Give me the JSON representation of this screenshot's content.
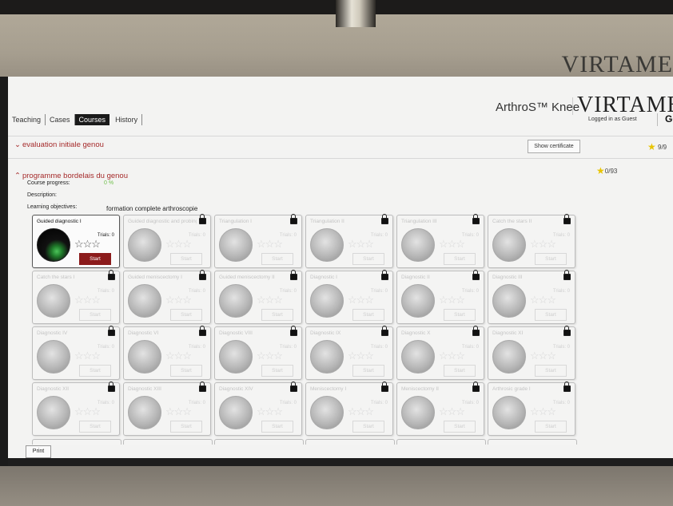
{
  "wall_brand": "VIRTAME",
  "header": {
    "app_title": "ArthroS™ Knee",
    "brand": "VIRTAMED",
    "logged_in": "Logged in as Guest",
    "logout_icon": "logout-icon"
  },
  "nav": {
    "tabs": [
      "Teaching",
      "Cases",
      "Courses",
      "History"
    ],
    "active": "Courses"
  },
  "section_evaluation": {
    "label": "evaluation initiale genou",
    "certificate_button": "Show certificate",
    "score": "9/9"
  },
  "section_programme": {
    "label": "programme bordelais du genou",
    "score": "0/93",
    "progress_label": "Course progress:",
    "progress_value": "0 %",
    "description_label": "Description:",
    "objectives_label": "Learning objectives:",
    "objectives_value": "formation complete arthroscopie"
  },
  "cards": [
    {
      "title": "Guided diagnostic I",
      "trials": "Trials: 0",
      "start": "Start",
      "locked": false
    },
    {
      "title": "Guided diagnostic and probing",
      "trials": "Trials: 0",
      "start": "Start",
      "locked": true
    },
    {
      "title": "Triangulation I",
      "trials": "Trials: 0",
      "start": "Start",
      "locked": true
    },
    {
      "title": "Triangulation II",
      "trials": "Trials: 0",
      "start": "Start",
      "locked": true
    },
    {
      "title": "Triangulation III",
      "trials": "Trials: 0",
      "start": "Start",
      "locked": true
    },
    {
      "title": "Catch the stars II",
      "trials": "Trials: 0",
      "start": "Start",
      "locked": true
    },
    {
      "title": "Catch the stars I",
      "trials": "Trials: 0",
      "start": "Start",
      "locked": true
    },
    {
      "title": "Guided meniscectomy I",
      "trials": "Trials: 0",
      "start": "Start",
      "locked": true
    },
    {
      "title": "Guided meniscectomy II",
      "trials": "Trials: 0",
      "start": "Start",
      "locked": true
    },
    {
      "title": "Diagnostic I",
      "trials": "Trials: 0",
      "start": "Start",
      "locked": true
    },
    {
      "title": "Diagnostic II",
      "trials": "Trials: 0",
      "start": "Start",
      "locked": true
    },
    {
      "title": "Diagnostic III",
      "trials": "Trials: 0",
      "start": "Start",
      "locked": true
    },
    {
      "title": "Diagnostic IV",
      "trials": "Trials: 0",
      "start": "Start",
      "locked": true
    },
    {
      "title": "Diagnostic VI",
      "trials": "Trials: 0",
      "start": "Start",
      "locked": true
    },
    {
      "title": "Diagnostic VIII",
      "trials": "Trials: 0",
      "start": "Start",
      "locked": true
    },
    {
      "title": "Diagnostic IX",
      "trials": "Trials: 0",
      "start": "Start",
      "locked": true
    },
    {
      "title": "Diagnostic X",
      "trials": "Trials: 0",
      "start": "Start",
      "locked": true
    },
    {
      "title": "Diagnostic XI",
      "trials": "Trials: 0",
      "start": "Start",
      "locked": true
    },
    {
      "title": "Diagnostic XII",
      "trials": "Trials: 0",
      "start": "Start",
      "locked": true
    },
    {
      "title": "Diagnostic XIII",
      "trials": "Trials: 0",
      "start": "Start",
      "locked": true
    },
    {
      "title": "Diagnostic XIV",
      "trials": "Trials: 0",
      "start": "Start",
      "locked": true
    },
    {
      "title": "Meniscectomy I",
      "trials": "Trials: 0",
      "start": "Start",
      "locked": true
    },
    {
      "title": "Meniscectomy II",
      "trials": "Trials: 0",
      "start": "Start",
      "locked": true
    },
    {
      "title": "Arthrosic grade I",
      "trials": "Trials: 0",
      "start": "Start",
      "locked": true
    }
  ],
  "stars_glyph": "☆☆☆",
  "print_button": "Print",
  "colors": {
    "section_header": "#a52a2a",
    "start_active": "#8b1b1b",
    "progress": "#6fbf4a",
    "score_star": "#e8c400"
  }
}
